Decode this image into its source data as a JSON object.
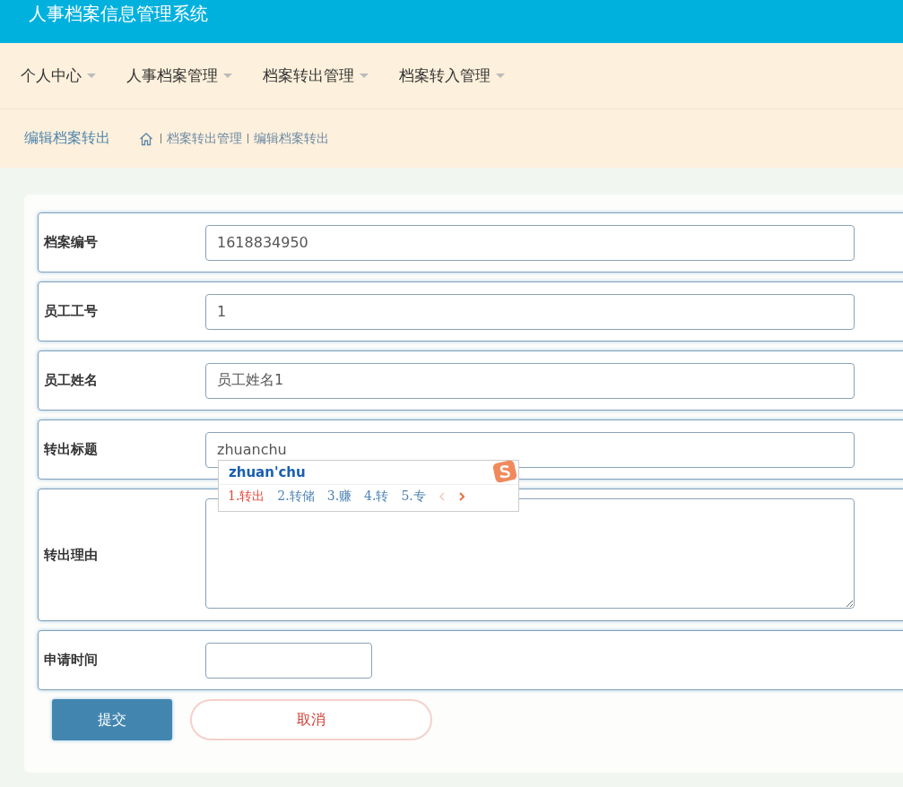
{
  "header": {
    "title": "人事档案信息管理系统"
  },
  "nav": [
    {
      "label": "个人中心"
    },
    {
      "label": "人事档案管理"
    },
    {
      "label": "档案转出管理"
    },
    {
      "label": "档案转入管理"
    }
  ],
  "breadcrumb": {
    "title": "编辑档案转出",
    "path": [
      "档案转出管理",
      "编辑档案转出"
    ]
  },
  "form": {
    "fields": [
      {
        "label": "档案编号",
        "kind": "input",
        "value": "1618834950"
      },
      {
        "label": "员工工号",
        "kind": "input",
        "value": "1"
      },
      {
        "label": "员工姓名",
        "kind": "input",
        "value": "员工姓名1"
      },
      {
        "label": "转出标题",
        "kind": "input",
        "value": "zhuanchu"
      },
      {
        "label": "转出理由",
        "kind": "textarea"
      },
      {
        "label": "申请时间",
        "kind": "date"
      }
    ],
    "buttons": [
      {
        "label": "提交",
        "kind": "primary"
      },
      {
        "label": "取消",
        "kind": "cancel"
      }
    ]
  },
  "ime": {
    "composition": "zhuan'chu",
    "candidates": [
      {
        "label": "1.转出",
        "selected": true
      },
      {
        "label": "2.转储",
        "selected": false
      },
      {
        "label": "3.赚",
        "selected": false
      },
      {
        "label": "4.转",
        "selected": false
      },
      {
        "label": "5.专",
        "selected": false
      }
    ]
  }
}
